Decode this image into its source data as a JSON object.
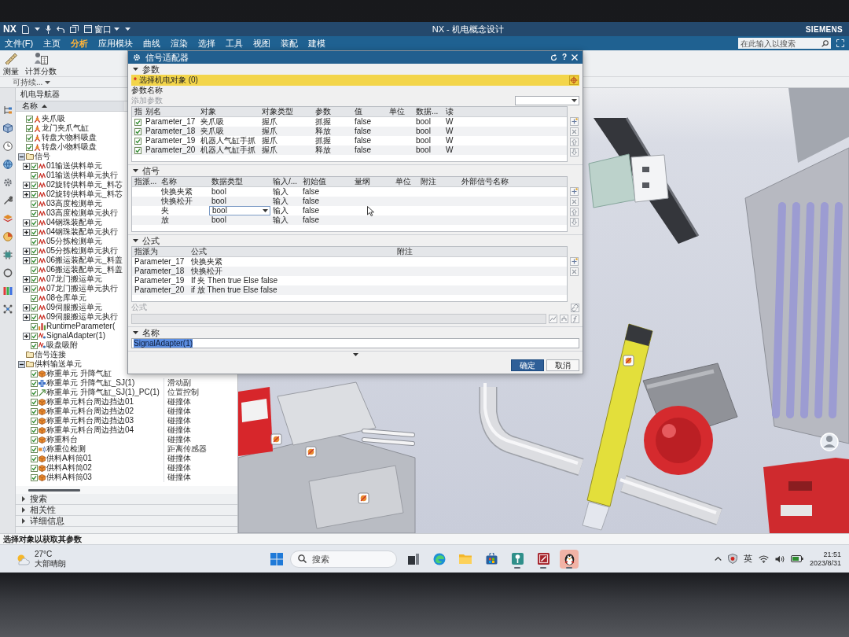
{
  "title_bar": {
    "logo": "NX",
    "window_menu": "窗口",
    "title": "NX - 机电概念设计",
    "brand": "SIEMENS"
  },
  "menu_tabs": [
    {
      "label": "文件(F)",
      "selected": false
    },
    {
      "label": "主页",
      "selected": false
    },
    {
      "label": "分析",
      "selected": true
    },
    {
      "label": "应用模块",
      "selected": false
    },
    {
      "label": "曲线",
      "selected": false
    },
    {
      "label": "渲染",
      "selected": false
    },
    {
      "label": "选择",
      "selected": false
    },
    {
      "label": "工具",
      "selected": false
    },
    {
      "label": "视图",
      "selected": false
    },
    {
      "label": "装配",
      "selected": false
    },
    {
      "label": "建模",
      "selected": false
    }
  ],
  "search": {
    "placeholder": "在此输入以搜索"
  },
  "ribbon": {
    "buttons": [
      {
        "kind": "measure",
        "label": "测量"
      },
      {
        "kind": "calculate",
        "label": "计算分数"
      }
    ],
    "group_label": "可持续..."
  },
  "navigator": {
    "title": "机电导航器",
    "column": "名称",
    "items": [
      {
        "label": "夹爪吸",
        "kind": "gripper",
        "checked": true
      },
      {
        "label": "龙门夹爪气缸",
        "kind": "gripper",
        "checked": true
      },
      {
        "label": "转盘大物料吸盘",
        "kind": "gripper",
        "checked": true
      },
      {
        "label": "转盘小物料吸盘",
        "kind": "gripper",
        "checked": true
      },
      {
        "label": "信号",
        "kind": "folder",
        "expanded": true,
        "children": [
          {
            "label": "01输送供料单元",
            "kind": "signal",
            "checked": true,
            "expanded": false
          },
          {
            "label": "01输送供料单元执行",
            "kind": "signal",
            "checked": true
          },
          {
            "label": "02旋转供料单元_料芯",
            "kind": "signal",
            "checked": true,
            "expanded": false
          },
          {
            "label": "02旋转供料单元_料芯",
            "kind": "signal",
            "checked": true,
            "expanded": false
          },
          {
            "label": "03高度检测单元",
            "kind": "signal",
            "checked": true
          },
          {
            "label": "03高度检测单元执行",
            "kind": "signal",
            "checked": true
          },
          {
            "label": "04钢珠装配单元",
            "kind": "signal",
            "checked": true,
            "expanded": false
          },
          {
            "label": "04钢珠装配单元执行",
            "kind": "signal",
            "checked": true,
            "expanded": false
          },
          {
            "label": "05分拣检测单元",
            "kind": "signal",
            "checked": true
          },
          {
            "label": "05分拣检测单元执行",
            "kind": "signal",
            "checked": true,
            "expanded": false
          },
          {
            "label": "06搬运装配单元_料盖",
            "kind": "signal",
            "checked": true,
            "expanded": false
          },
          {
            "label": "06搬运装配单元_料盖",
            "kind": "signal",
            "checked": true
          },
          {
            "label": "07龙门搬运单元",
            "kind": "signal",
            "checked": true,
            "expanded": false
          },
          {
            "label": "07龙门搬运单元执行",
            "kind": "signal",
            "checked": true,
            "expanded": false
          },
          {
            "label": "08仓库单元",
            "kind": "signal",
            "checked": true
          },
          {
            "label": "09伺服搬运单元",
            "kind": "signal",
            "checked": true,
            "expanded": false
          },
          {
            "label": "09伺服搬运单元执行",
            "kind": "signal",
            "checked": true,
            "expanded": false
          },
          {
            "label": "RuntimeParameter(",
            "kind": "parameter",
            "checked": true
          },
          {
            "label": "SignalAdapter(1)",
            "kind": "adapter",
            "checked": true,
            "expanded": false
          },
          {
            "label": "吸盘吸附",
            "kind": "adapter",
            "checked": true
          }
        ]
      },
      {
        "label": "信号连接",
        "kind": "folder"
      },
      {
        "label": "供料输送单元",
        "kind": "folder",
        "expanded": true,
        "children": [
          {
            "label": "称重单元 升降气缸",
            "kind": "body",
            "checked": true
          },
          {
            "label": "称重单元 升降气缸_SJ(1)",
            "kind": "joint",
            "checked": true,
            "type": "滑动副"
          },
          {
            "label": "称重单元 升降气缸_SJ(1)_PC(1)",
            "kind": "control",
            "checked": true,
            "type": "位置控制"
          },
          {
            "label": "称重单元料台周边挡边01",
            "kind": "body",
            "checked": true,
            "type": "碰撞体"
          },
          {
            "label": "称重单元料台周边挡边02",
            "kind": "body",
            "checked": true,
            "type": "碰撞体"
          },
          {
            "label": "称重单元料台周边挡边03",
            "kind": "body",
            "checked": true,
            "type": "碰撞体"
          },
          {
            "label": "称重单元料台周边挡边04",
            "kind": "body",
            "checked": true,
            "type": "碰撞体"
          },
          {
            "label": "称重料台",
            "kind": "body",
            "checked": true,
            "type": "碰撞体"
          },
          {
            "label": "称重位检测",
            "kind": "sensor",
            "checked": true,
            "type": "距离传感器"
          },
          {
            "label": "供料A料筒01",
            "kind": "body",
            "checked": true,
            "type": "碰撞体"
          },
          {
            "label": "供料A料筒02",
            "kind": "body",
            "checked": true,
            "type": "碰撞体"
          },
          {
            "label": "供料A料筒03",
            "kind": "body",
            "checked": true,
            "type": "碰撞体"
          }
        ]
      }
    ]
  },
  "bottom_panels": [
    {
      "label": "搜索",
      "expanded": false
    },
    {
      "label": "相关性",
      "expanded": false
    },
    {
      "label": "详细信息",
      "expanded": false
    }
  ],
  "dialog": {
    "title": "信号适配器",
    "help": "?",
    "parameters": {
      "header": "参数",
      "expanded": true,
      "required_mark": "*",
      "select_label": "选择机电对象 (0)",
      "name_label": "参数名称",
      "add_label": "添加参数",
      "add_disabled": true,
      "columns": [
        "指",
        "别名",
        "对象",
        "对象类型",
        "参数",
        "值",
        "单位",
        "数据...",
        "读"
      ],
      "rows": [
        {
          "checked": true,
          "alias": "Parameter_17",
          "object": "夹爪吸",
          "object_type": "握爪",
          "parameter": "抓握",
          "value": "false",
          "data_type": "bool",
          "read": "W"
        },
        {
          "checked": true,
          "alias": "Parameter_18",
          "object": "夹爪吸",
          "object_type": "握爪",
          "parameter": "释放",
          "value": "false",
          "data_type": "bool",
          "read": "W"
        },
        {
          "checked": true,
          "alias": "Parameter_19",
          "object": "机器人气缸手抓",
          "object_type": "握爪",
          "parameter": "抓握",
          "value": "false",
          "data_type": "bool",
          "read": "W"
        },
        {
          "checked": true,
          "alias": "Parameter_20",
          "object": "机器人气缸手抓",
          "object_type": "握爪",
          "parameter": "释放",
          "value": "false",
          "data_type": "bool",
          "read": "W"
        }
      ]
    },
    "signals": {
      "header": "信号",
      "expanded": true,
      "columns": [
        "指派...",
        "名称",
        "数据类型",
        "输入/...",
        "初始值",
        "量纲",
        "单位",
        "附注",
        "外部信号名称"
      ],
      "rows": [
        {
          "name": "快换夹紧",
          "data_type": "bool",
          "io": "输入",
          "initial": "false",
          "editing": false
        },
        {
          "name": "快换松开",
          "data_type": "bool",
          "io": "输入",
          "initial": "false",
          "editing": false
        },
        {
          "name": "夹",
          "data_type": "bool",
          "io": "输入",
          "initial": "false",
          "editing": true
        },
        {
          "name": "放",
          "data_type": "bool",
          "io": "输入",
          "initial": "false",
          "editing": false
        }
      ]
    },
    "formulas": {
      "header": "公式",
      "expanded": true,
      "columns": [
        "指派为",
        "公式",
        "附注"
      ],
      "rows": [
        {
          "assign_to": "Parameter_17",
          "formula": "快换夹紧"
        },
        {
          "assign_to": "Parameter_18",
          "formula": "快换松开"
        },
        {
          "assign_to": "Parameter_19",
          "formula": "If 夹 Then true Else false"
        },
        {
          "assign_to": "Parameter_20",
          "formula": "if 放 Then true Else false"
        }
      ],
      "field_label": "公式",
      "field_disabled": true
    },
    "name": {
      "header": "名称",
      "expanded": true,
      "value": "SignalAdapter(1)",
      "selected": true
    },
    "buttons": [
      {
        "label": "确定",
        "primary": true
      },
      {
        "label": "取消",
        "primary": false
      }
    ]
  },
  "status_bar": {
    "text": "选择对象以获取其参数"
  },
  "taskbar": {
    "weather": {
      "temperature": "27°C",
      "condition": "大部晴朗"
    },
    "search": {
      "placeholder": "搜索"
    },
    "apps": [
      {
        "kind": "task-view",
        "running": false,
        "flashing": false
      },
      {
        "kind": "browser",
        "running": false,
        "flashing": false
      },
      {
        "kind": "folder",
        "running": false,
        "flashing": false
      },
      {
        "kind": "store",
        "running": false,
        "flashing": false
      },
      {
        "kind": "pin",
        "running": true,
        "flashing": false
      },
      {
        "kind": "nx",
        "running": true,
        "flashing": false
      },
      {
        "kind": "penguin",
        "running": true,
        "flashing": true
      }
    ],
    "ime": "英",
    "time": "21:51",
    "date": "2023/8/31"
  }
}
